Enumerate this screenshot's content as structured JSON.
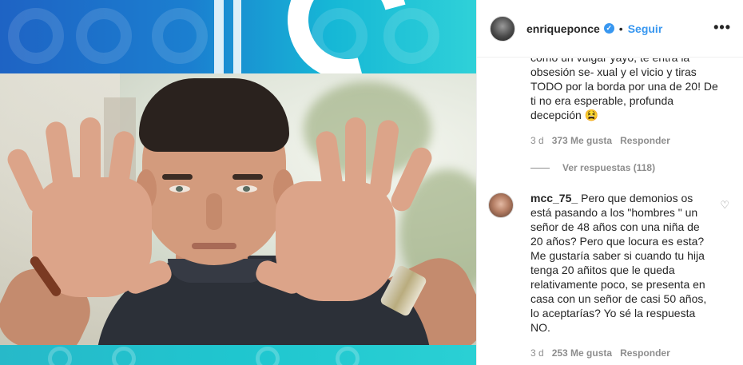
{
  "post": {
    "author": {
      "username": "enriqueponce",
      "verified_icon": "verified-badge-icon",
      "separator": "•",
      "follow_label": "Seguir",
      "more_icon": "•••"
    }
  },
  "comments": [
    {
      "text_lines": "como un vulgar yayo, te entra la obsesión se- xual y el vicio y tiras TODO por la borda por una de 20! De ti no era esperable, profunda decepción 😫",
      "time": "3 d",
      "likes": "373 Me gusta",
      "reply_label": "Responder",
      "view_replies": "Ver respuestas (118)"
    },
    {
      "username": "mcc_75_",
      "text": "Pero que demonios os está pasando a los \"hombres \" un señor de 48 años con una niña de 20 años? Pero que locura es esta? Me gustaría saber si cuando tu hija tenga 20 añitos que le queda relativamente poco, se presenta en casa con un señor de casi 50 años, lo aceptarías? Yo sé la respuesta NO.",
      "time": "3 d",
      "likes": "253 Me gusta",
      "reply_label": "Responder",
      "like_icon": "♡"
    }
  ],
  "colors": {
    "link_blue": "#3897f0",
    "text_dark": "#262626",
    "text_muted": "#8e8e8e",
    "brand_teal": "#1fc6cf",
    "brand_blue": "#1e63c4"
  }
}
